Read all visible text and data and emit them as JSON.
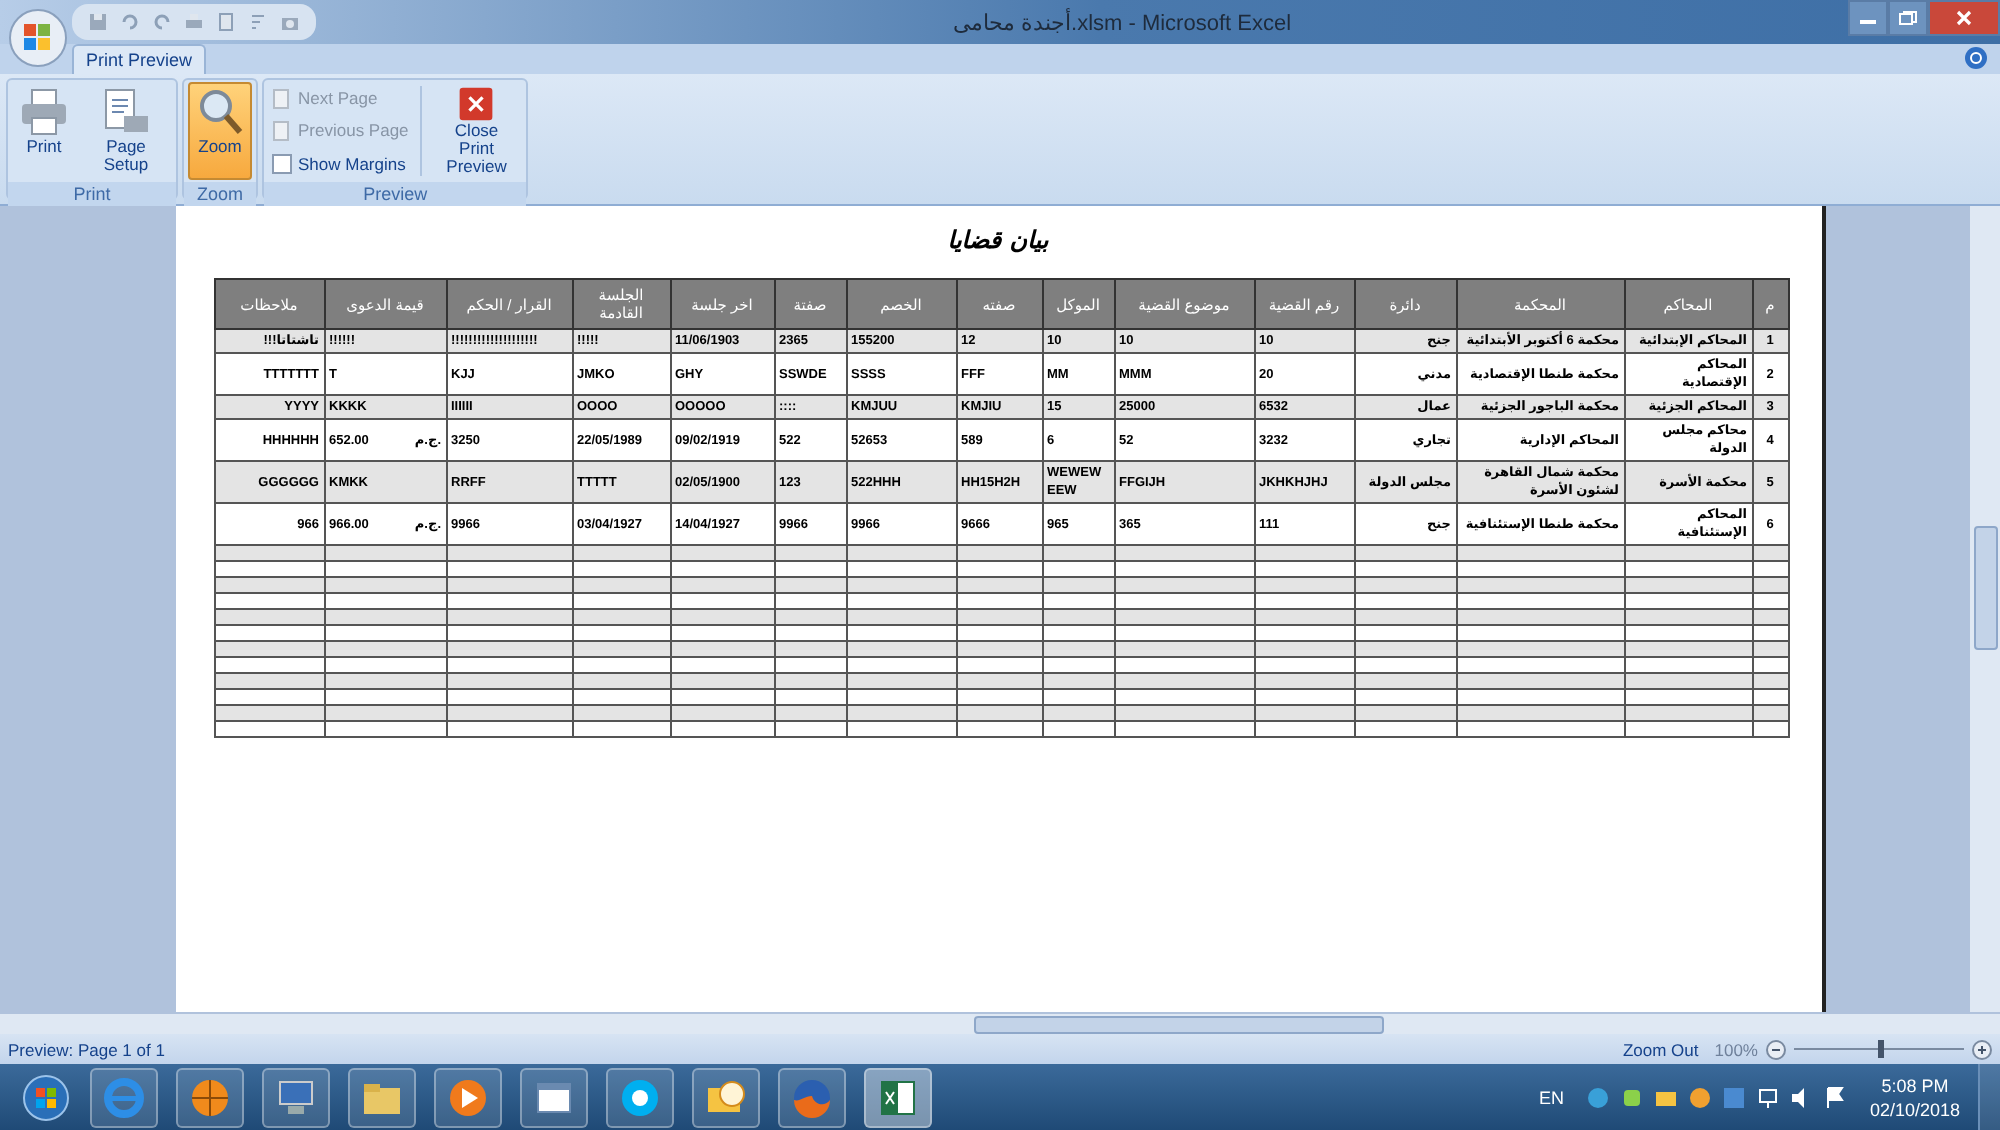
{
  "window": {
    "title": "أجندة محامى.xlsm - Microsoft Excel"
  },
  "tabs": [
    {
      "label": "Print Preview",
      "selected": true
    }
  ],
  "ribbon": {
    "print_group": {
      "label": "Print",
      "print_button": {
        "label": "Print",
        "selected": false
      },
      "page_setup_button": {
        "label": "Page Setup",
        "selected": false
      }
    },
    "zoom_group": {
      "label": "Zoom",
      "zoom_button": {
        "label": "Zoom",
        "selected": true
      }
    },
    "preview_group": {
      "label": "Preview",
      "next_page": {
        "label": "Next Page",
        "disabled": true
      },
      "previous_page": {
        "label": "Previous Page",
        "disabled": true
      },
      "show_margins": {
        "label": "Show Margins",
        "checked": false
      },
      "close_print_preview": {
        "label": "Close Print Preview",
        "selected": false
      }
    }
  },
  "page": {
    "title": "بيان قضايا",
    "columns": [
      "م",
      "المحاكم",
      "المحكمة",
      "دائرة",
      "رقم القضية",
      "موضوع القضية",
      "الموكل",
      "صفته",
      "الخصم",
      "صفتة",
      "اخر جلسة",
      "الجلسة القادمة",
      "القرار / الحكم",
      "قيمة الدعوى",
      "ملاحظات"
    ],
    "rows": [
      [
        "1",
        "المحاكم الإبتدائية",
        "محكمة 6 أكتوبر الأبتدائية",
        "جنح",
        "10",
        "10",
        "10",
        "12",
        "155200",
        "2365",
        "11/06/1903",
        "!!!!!",
        "!!!!!!!!!!!!!!!!!!!!",
        "!!!!!!",
        "تاشتاتا!!!"
      ],
      [
        "2",
        "المحاكم الإقتصادية",
        "محكمة طنطا الإقتصادية",
        "مدني",
        "20",
        "MMM",
        "MM",
        "FFF",
        "SSSS",
        "SSWDE",
        "GHY",
        "JMKO",
        "KJJ",
        "T",
        "TTTTTTT"
      ],
      [
        "3",
        "المحاكم الجزئية",
        "محكمة الباجور الجزئية",
        "عمال",
        "6532",
        "25000",
        "15",
        "KMJIU",
        "KMJUU",
        "::::",
        "OOOOO",
        "OOOO",
        "IIIIII",
        "KKKK",
        "YYYY"
      ],
      [
        "4",
        "محاكم مجلس الدولة",
        "المحاكم الإدارية",
        "تجاري",
        "3232",
        "52",
        "6",
        "589",
        "52653",
        "522",
        "09/02/1919",
        "22/05/1989",
        "3250",
        {
          "amount": "652.00",
          "unit": "ج.م."
        },
        "HHHHHH"
      ],
      [
        "5",
        "محكمة الأسرة",
        "محكمة شمال القاهرة لشئون الأسرة",
        "مجلس الدولة",
        "JKHKHJHJ",
        "FFGIJH",
        "WEWEW EEW",
        "HH15H2H",
        "522HHH",
        "123",
        "02/05/1900",
        "TTTTT",
        "RRFF",
        "KMKK",
        "GGGGGG"
      ],
      [
        "6",
        "المحاكم الإستئنافية",
        "محكمة طنطا الإستئنافية",
        "جنح",
        "111",
        "365",
        "965",
        "9666",
        "9966",
        "9966",
        "14/04/1927",
        "03/04/1927",
        "9966",
        {
          "amount": "966.00",
          "unit": "ج.م."
        },
        "966"
      ]
    ]
  },
  "status_bar": {
    "text": "Preview: Page 1 of 1",
    "zoom_out": "Zoom Out",
    "zoom_percent": "100%",
    "zoom_slider": {
      "level": 0.5
    }
  },
  "taskbar": {
    "apps": [
      {
        "selected": false
      },
      {
        "selected": false
      },
      {
        "selected": false
      },
      {
        "selected": false
      },
      {
        "selected": false
      },
      {
        "selected": false
      },
      {
        "selected": false
      },
      {
        "selected": false
      },
      {
        "selected": false
      },
      {
        "selected": true
      }
    ],
    "language": "EN",
    "time": "5:08 PM",
    "date": "02/10/2018"
  }
}
